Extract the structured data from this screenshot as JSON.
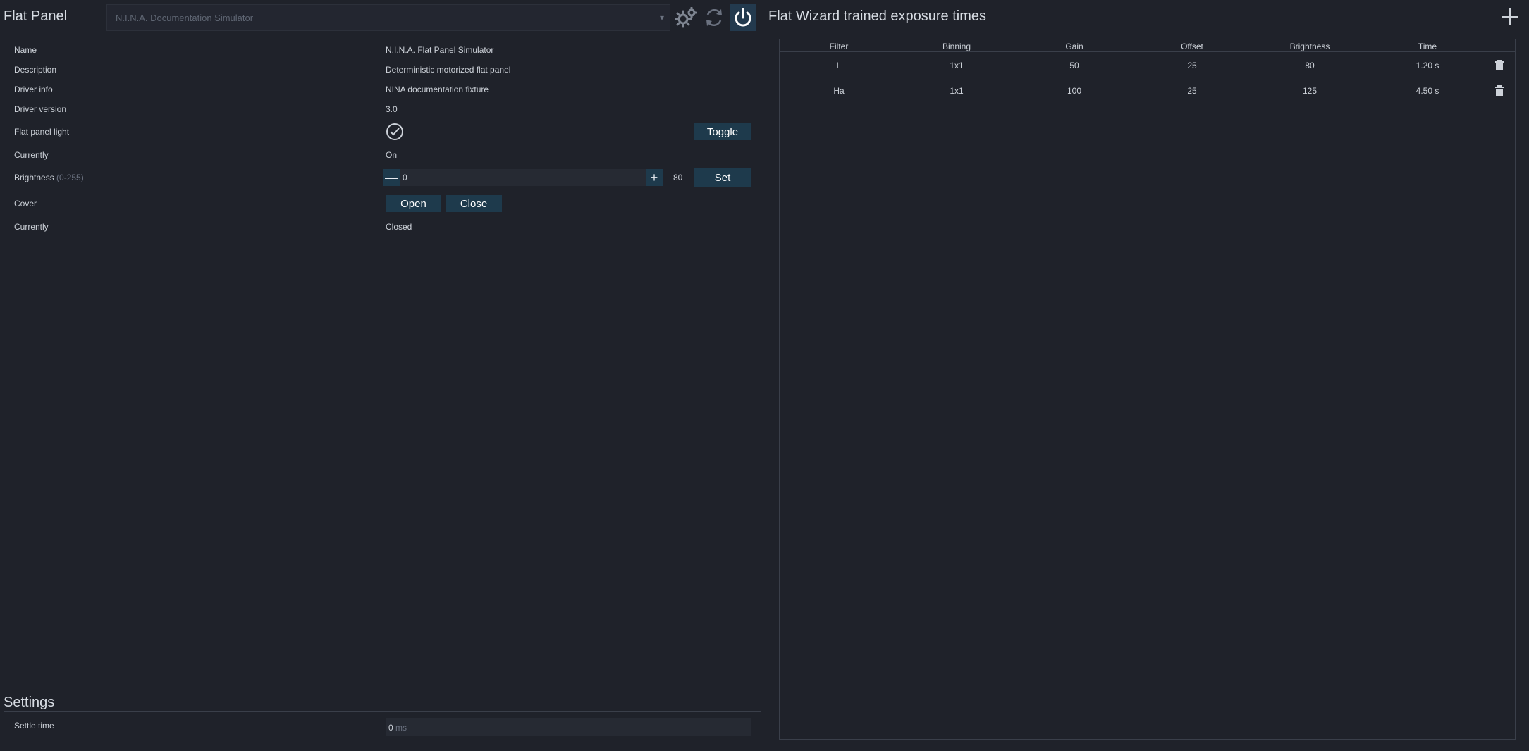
{
  "header": {
    "title": "Flat Panel",
    "device_select_value": "N.I.N.A. Documentation Simulator"
  },
  "info": {
    "name_label": "Name",
    "name_value": "N.I.N.A. Flat Panel Simulator",
    "description_label": "Description",
    "description_value": "Deterministic motorized flat panel",
    "driver_info_label": "Driver info",
    "driver_info_value": "NINA documentation fixture",
    "driver_version_label": "Driver version",
    "driver_version_value": "3.0",
    "light_label": "Flat panel light",
    "toggle_label": "Toggle",
    "light_state_label": "Currently",
    "light_state_value": "On",
    "brightness_label": "Brightness",
    "brightness_range": "(0-255)",
    "brightness_input_value": "0",
    "brightness_current": "80",
    "set_label": "Set",
    "cover_label": "Cover",
    "open_label": "Open",
    "close_label": "Close",
    "cover_state_label": "Currently",
    "cover_state_value": "Closed"
  },
  "settings": {
    "title": "Settings",
    "settle_time_label": "Settle time",
    "settle_time_value": "0",
    "settle_time_unit": "ms"
  },
  "wizard": {
    "title": "Flat Wizard trained exposure times",
    "columns": [
      "Filter",
      "Binning",
      "Gain",
      "Offset",
      "Brightness",
      "Time"
    ],
    "rows": [
      [
        "L",
        "1x1",
        "50",
        "25",
        "80",
        "1.20 s"
      ],
      [
        "Ha",
        "1x1",
        "100",
        "25",
        "125",
        "4.50 s"
      ]
    ]
  },
  "icons": {
    "settings": "gears-icon",
    "refresh": "refresh-icon",
    "power": "power-icon",
    "light_on": "check-circle-icon",
    "add": "plus-icon",
    "delete": "trash-icon"
  },
  "colors": {
    "background": "#1f222a",
    "button": "#1e3a4c",
    "text": "#d7dce3"
  }
}
